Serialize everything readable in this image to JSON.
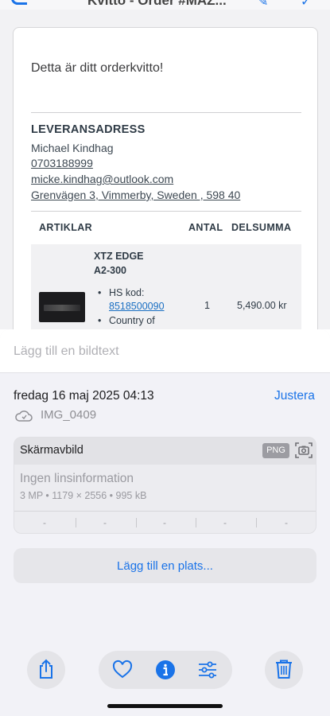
{
  "topbar": {
    "title": "Kvitto - Order #MAZ..."
  },
  "receipt": {
    "heading": "Detta är ditt orderkvitto!",
    "address_title": "LEVERANSADRESS",
    "name": "Michael Kindhag",
    "phone": "0703188999",
    "email": "micke.kindhag@outlook.com",
    "address": "Grenvägen 3, Vimmerby, Sweden , 598 40",
    "table_headers": {
      "items": "ARTIKLAR",
      "qty": "ANTAL",
      "subtotal": "DELSUMMA"
    },
    "item": {
      "name_line1": "XTZ EDGE",
      "name_line2": "A2-300",
      "hs_label": "HS kod:",
      "hs_code": "8518500090",
      "country_label": "Country of",
      "qty": "1",
      "price": "5,490.00 kr"
    }
  },
  "sheet": {
    "caption_placeholder": "Lägg till en bildtext",
    "date": "fredag 16 maj 2025 04:13",
    "adjust": "Justera",
    "filename": "IMG_0409",
    "card_title": "Skärmavbild",
    "format_badge": "PNG",
    "lens": "Ingen linsinformation",
    "specs": "3 MP • 1179 × 2556 • 995 kB",
    "exif": [
      "-",
      "-",
      "-",
      "-",
      "-"
    ],
    "add_place": "Lägg till en plats..."
  },
  "toolbar": {
    "icons": [
      "share-icon",
      "heart-icon",
      "info-icon",
      "adjust-icon",
      "trash-icon"
    ],
    "accent": "#1a73e8"
  }
}
